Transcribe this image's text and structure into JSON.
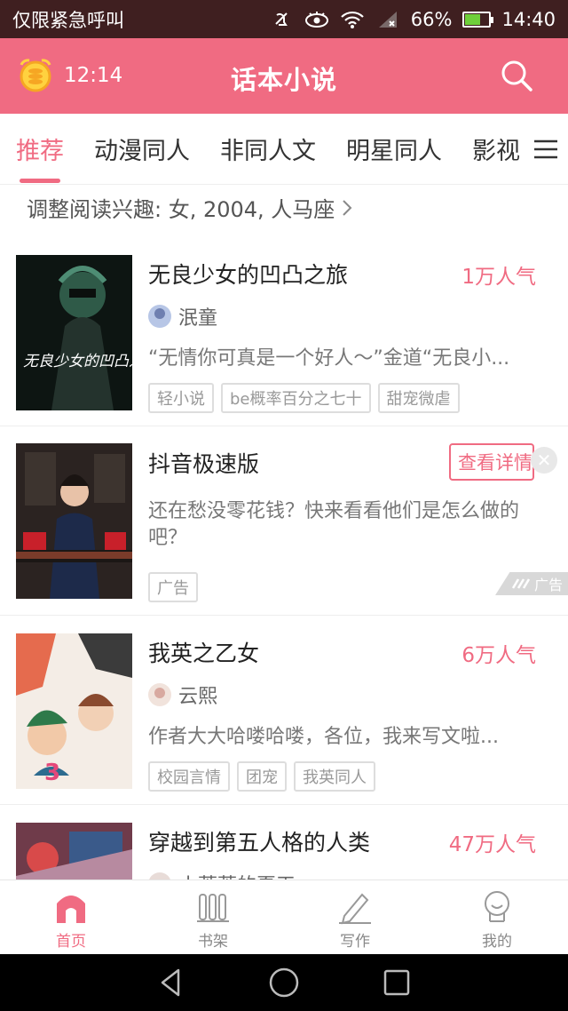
{
  "status_bar": {
    "carrier": "仅限紧急呼叫",
    "battery": "66%",
    "time": "14:40",
    "battery_level": 0.66
  },
  "header": {
    "timer": "12:14",
    "title": "话本小说"
  },
  "tabs": [
    "推荐",
    "动漫同人",
    "非同人文",
    "明星同人",
    "影视"
  ],
  "interest": {
    "label": "调整阅读兴趣: 女, 2004, 人马座"
  },
  "feed": [
    {
      "title": "无良少女的凹凸之旅",
      "popularity": "1万人气",
      "author": "泯童",
      "description": "“无情你可真是一个好人～”金道“无良小...",
      "tags": [
        "轻小说",
        "be概率百分之七十",
        "甜宠微虐"
      ],
      "cover_text": "无良少女的凹凸之旅"
    },
    {
      "title": "抖音极速版",
      "detail_button": "查看详情",
      "description": "还在愁没零花钱？快来看看他们是怎么做的吧？",
      "tags": [
        "广告"
      ],
      "ad_badge": "广告"
    },
    {
      "title": "我英之乙女",
      "popularity": "6万人气",
      "author": "云熙",
      "description": "作者大大哈喽哈喽，各位，我来写文啦...",
      "tags": [
        "校园言情",
        "团宠",
        "我英同人"
      ]
    },
    {
      "title": "穿越到第五人格的人类",
      "popularity": "47万人气",
      "author": "小蒂蒂的夏天"
    }
  ],
  "bottom_nav": [
    {
      "label": "首页",
      "icon": "home-icon",
      "active": true
    },
    {
      "label": "书架",
      "icon": "bookshelf-icon",
      "active": false
    },
    {
      "label": "写作",
      "icon": "pen-icon",
      "active": false
    },
    {
      "label": "我的",
      "icon": "profile-icon",
      "active": false
    }
  ],
  "colors": {
    "accent": "#f06b82",
    "status_bar": "#3f1f20"
  }
}
